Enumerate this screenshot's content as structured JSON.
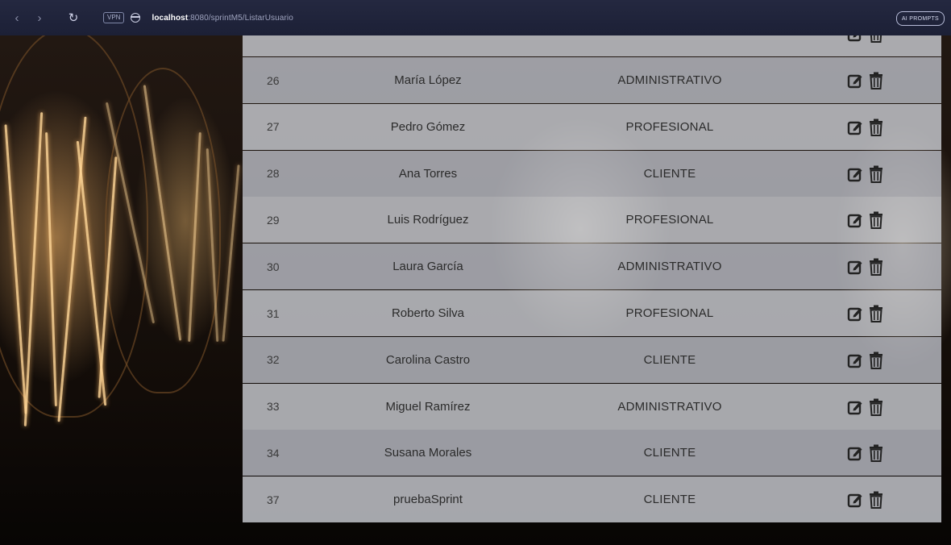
{
  "browser": {
    "vpn_label": "VPN",
    "url_host": "localhost",
    "url_path": ":8080/sprintM5/ListarUsuario",
    "extension_label": "AI PROMPTS"
  },
  "table": {
    "rows": [
      {
        "id": "26",
        "name": "María López",
        "role": "ADMINISTRATIVO"
      },
      {
        "id": "27",
        "name": "Pedro Gómez",
        "role": "PROFESIONAL"
      },
      {
        "id": "28",
        "name": "Ana Torres",
        "role": "CLIENTE"
      },
      {
        "id": "29",
        "name": "Luis Rodríguez",
        "role": "PROFESIONAL"
      },
      {
        "id": "30",
        "name": "Laura García",
        "role": "ADMINISTRATIVO"
      },
      {
        "id": "31",
        "name": "Roberto Silva",
        "role": "PROFESIONAL"
      },
      {
        "id": "32",
        "name": "Carolina Castro",
        "role": "CLIENTE"
      },
      {
        "id": "33",
        "name": "Miguel Ramírez",
        "role": "ADMINISTRATIVO"
      },
      {
        "id": "34",
        "name": "Susana Morales",
        "role": "CLIENTE"
      },
      {
        "id": "37",
        "name": "pruebaSprint",
        "role": "CLIENTE"
      }
    ]
  },
  "icons": {
    "edit": "edit-icon",
    "delete": "trash-icon"
  },
  "colors": {
    "browser_bar": "#1c2036",
    "row_light": "#cdcfd6",
    "row_dark": "#b9bcc4",
    "icon": "#222222"
  }
}
